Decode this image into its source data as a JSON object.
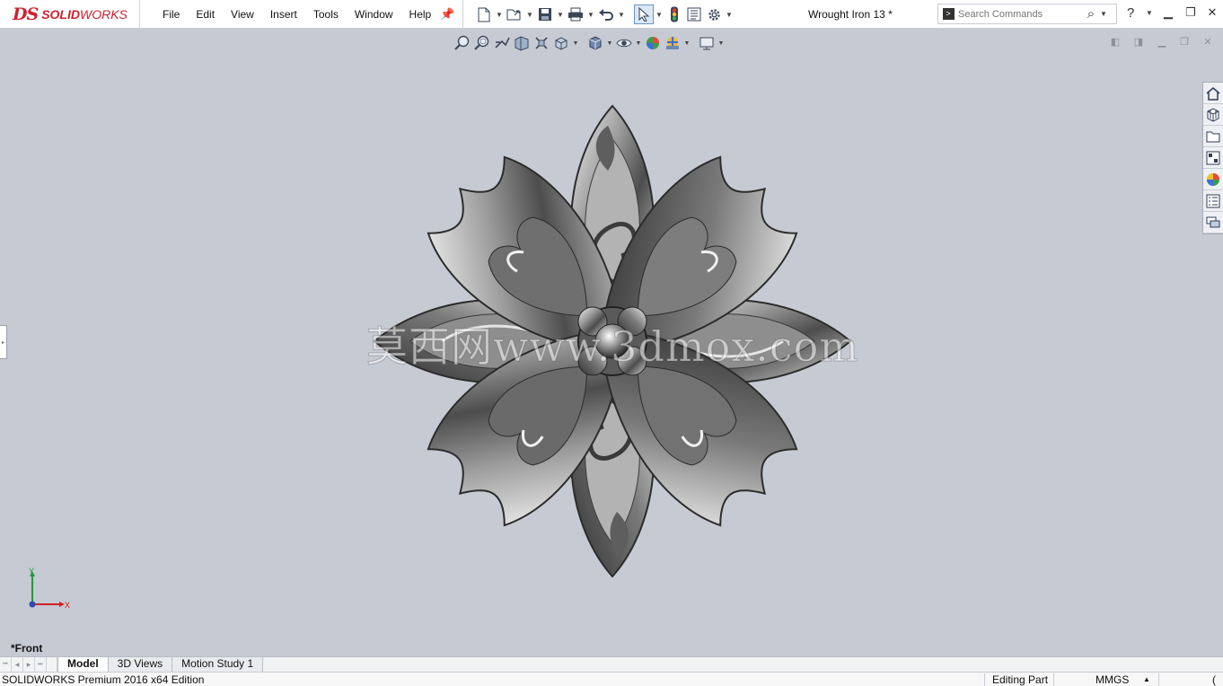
{
  "app": {
    "brand_prefix": "DS",
    "brand_name_bold": "SOLID",
    "brand_name_rest": "WORKS"
  },
  "menu": [
    "File",
    "Edit",
    "View",
    "Insert",
    "Tools",
    "Window",
    "Help"
  ],
  "document": {
    "title": "Wrought Iron 13 *"
  },
  "search": {
    "placeholder": "Search Commands"
  },
  "quick_toolbar": [
    "new-document-icon",
    "open-icon",
    "save-icon",
    "print-icon",
    "undo-icon",
    "select-arrow-icon",
    "rebuild-traffic-light-icon",
    "file-properties-icon",
    "options-gear-icon"
  ],
  "view_toolbar": [
    "zoom-to-fit-icon",
    "zoom-to-area-icon",
    "previous-view-icon",
    "section-view-icon",
    "dynamic-annotation-icon",
    "view-orientation-icon",
    "display-style-icon",
    "hide-show-items-icon",
    "edit-appearance-icon",
    "apply-scene-icon",
    "view-settings-icon"
  ],
  "task_pane": [
    "home-icon",
    "design-library-icon",
    "file-explorer-icon",
    "view-palette-icon",
    "appearances-icon",
    "custom-properties-icon",
    "forum-icon"
  ],
  "watermark": "莫西网www.3dmox.com",
  "triad": {
    "y": "Y",
    "x": "X"
  },
  "view_label": "*Front",
  "tabs": [
    "Model",
    "3D Views",
    "Motion Study 1"
  ],
  "status": {
    "edition": "SOLIDWORKS Premium 2016 x64 Edition",
    "mode": "Editing Part",
    "units": "MMGS",
    "units_arrow": "▲",
    "tail": "("
  },
  "colors": {
    "brand_red": "#d1202f",
    "viewport": "#c6cad3",
    "accent_blue": "#2e7fd6"
  }
}
